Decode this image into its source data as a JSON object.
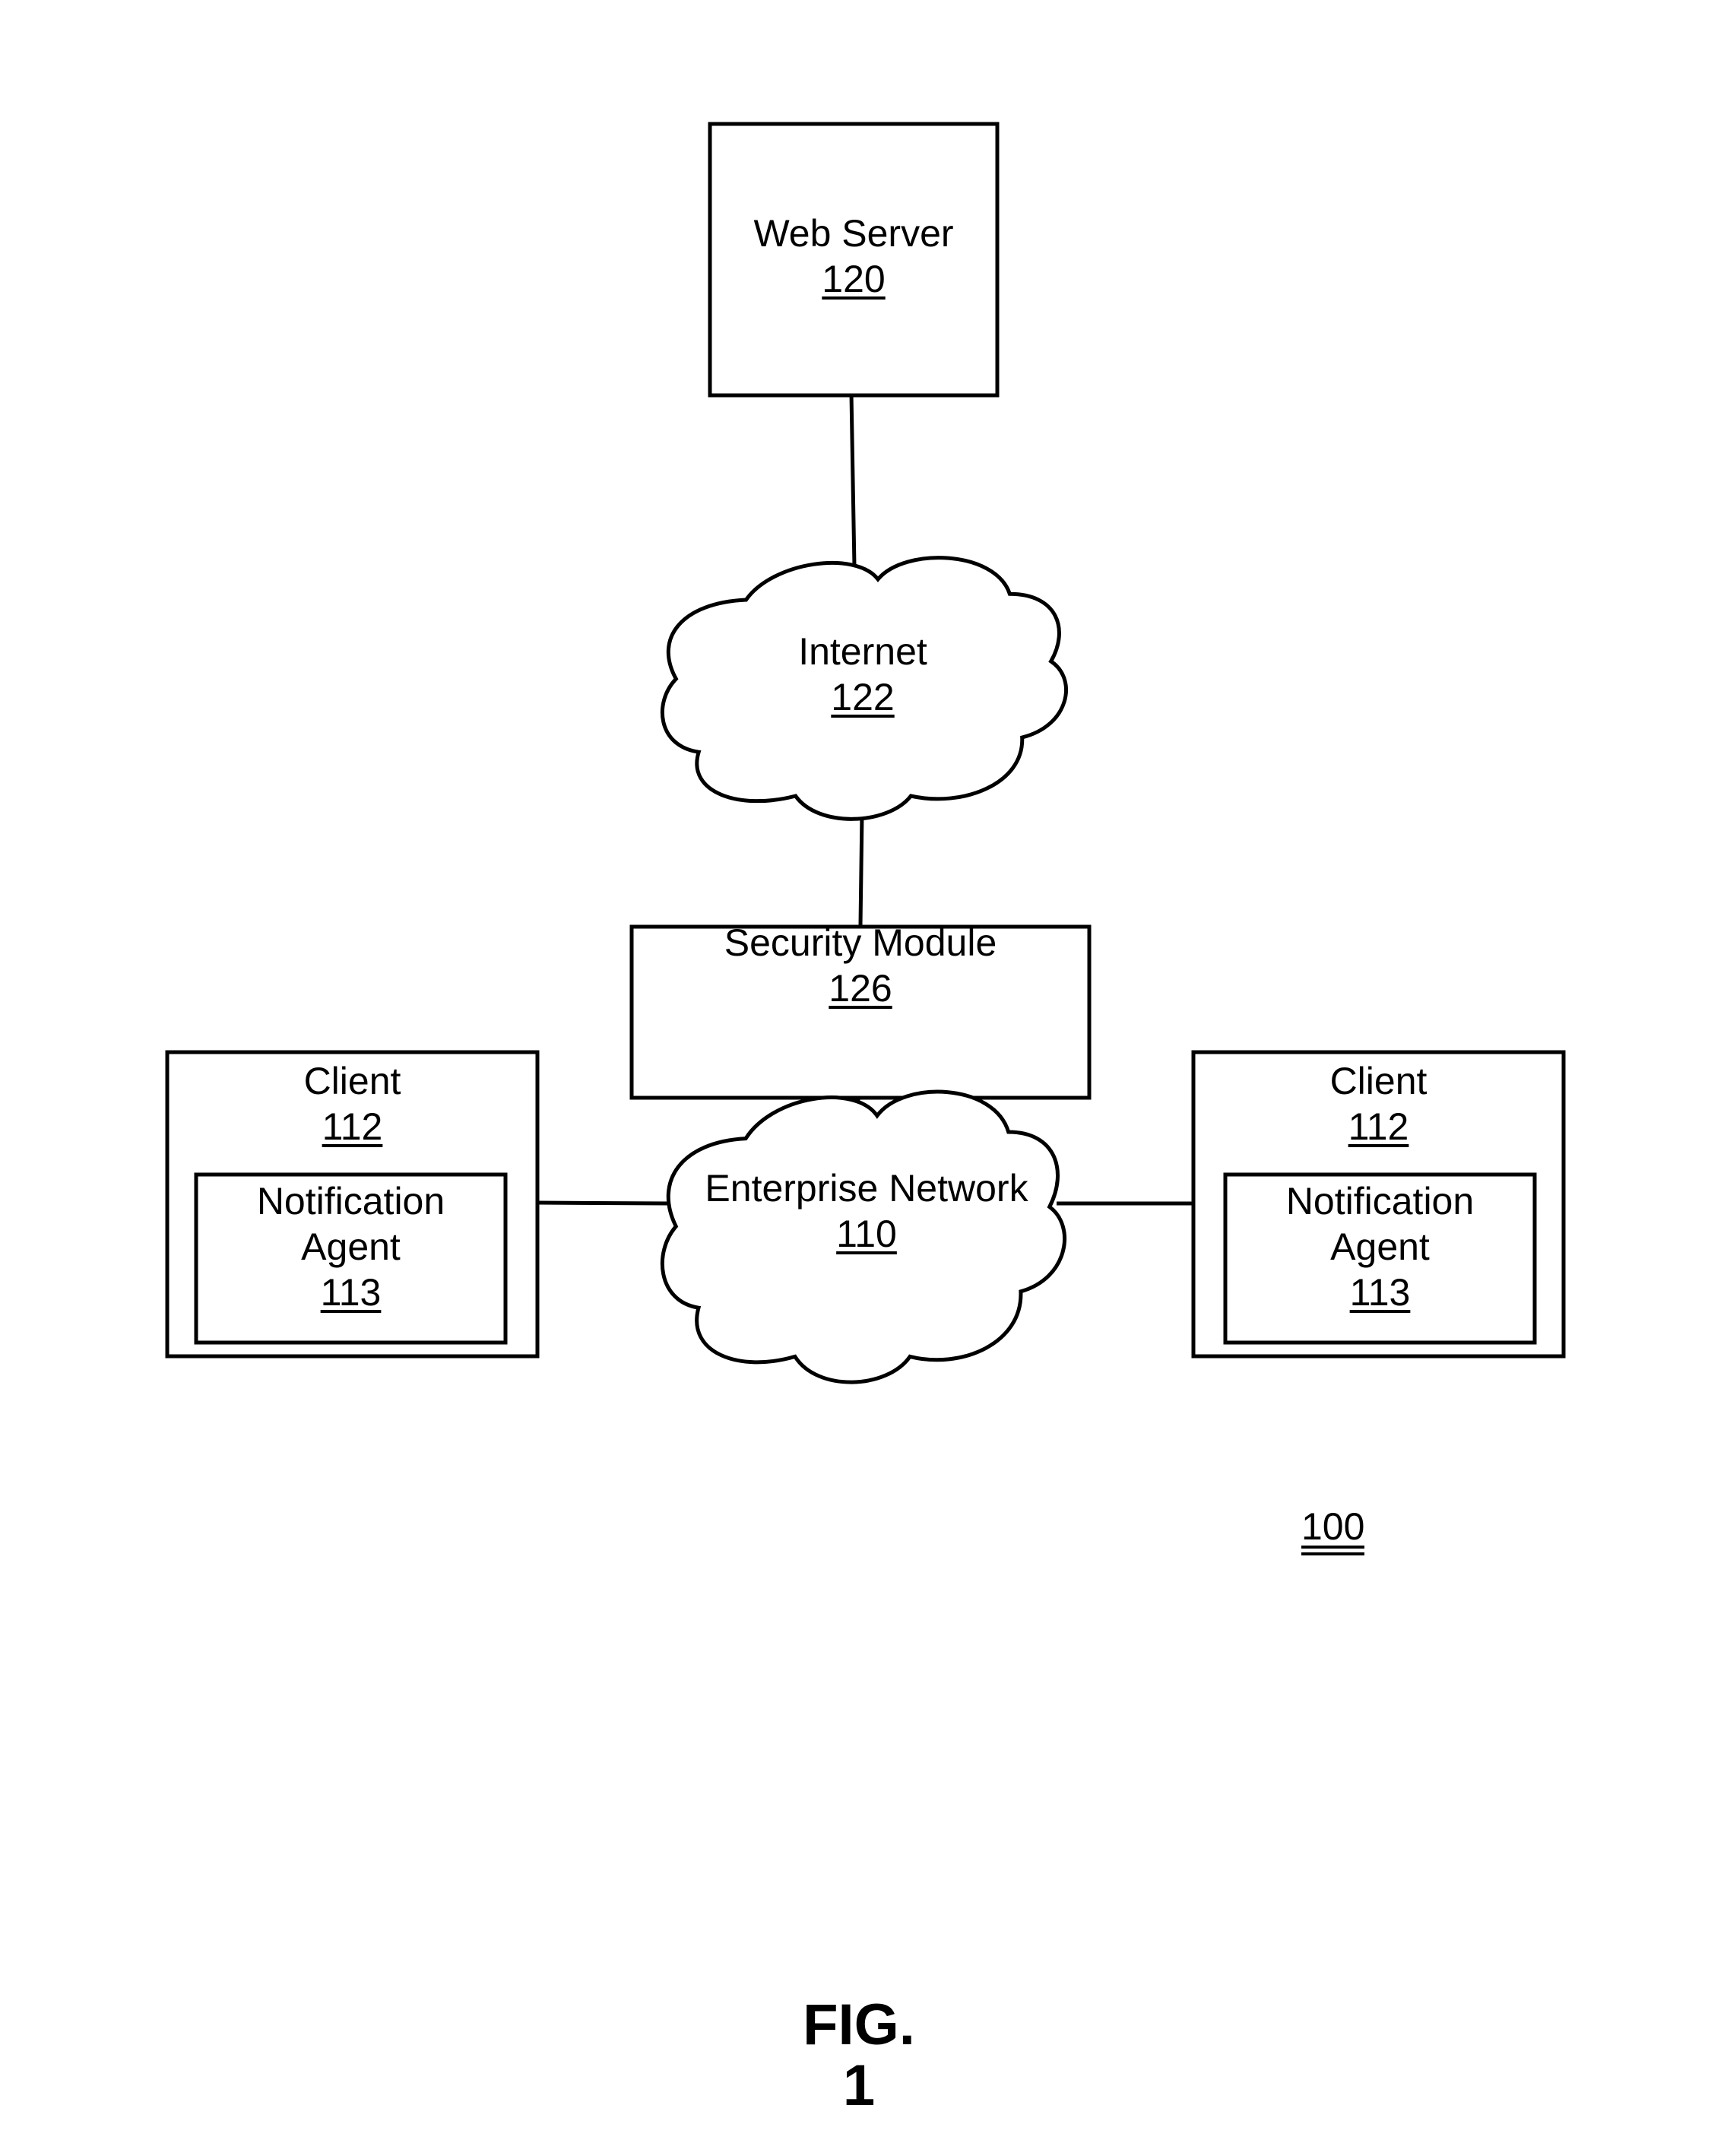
{
  "figure": {
    "caption": "FIG. 1",
    "system_ref": "100"
  },
  "nodes": {
    "web_server": {
      "title": "Web Server",
      "ref": "120",
      "shape": "rectangle"
    },
    "internet": {
      "title": "Internet",
      "ref": "122",
      "shape": "cloud"
    },
    "security_module": {
      "title": "Security Module",
      "ref": "126",
      "shape": "rectangle"
    },
    "enterprise_network": {
      "title": "Enterprise Network",
      "ref": "110",
      "shape": "cloud"
    },
    "client_left": {
      "title": "Client",
      "ref": "112",
      "shape": "rectangle",
      "agent": {
        "title_line1": "Notification",
        "title_line2": "Agent",
        "ref": "113"
      }
    },
    "client_right": {
      "title": "Client",
      "ref": "112",
      "shape": "rectangle",
      "agent": {
        "title_line1": "Notification",
        "title_line2": "Agent",
        "ref": "113"
      }
    }
  },
  "edges": [
    {
      "from": "web_server",
      "to": "internet"
    },
    {
      "from": "internet",
      "to": "security_module"
    },
    {
      "from": "security_module",
      "to": "enterprise_network"
    },
    {
      "from": "client_left",
      "to": "enterprise_network"
    },
    {
      "from": "enterprise_network",
      "to": "client_right"
    }
  ]
}
